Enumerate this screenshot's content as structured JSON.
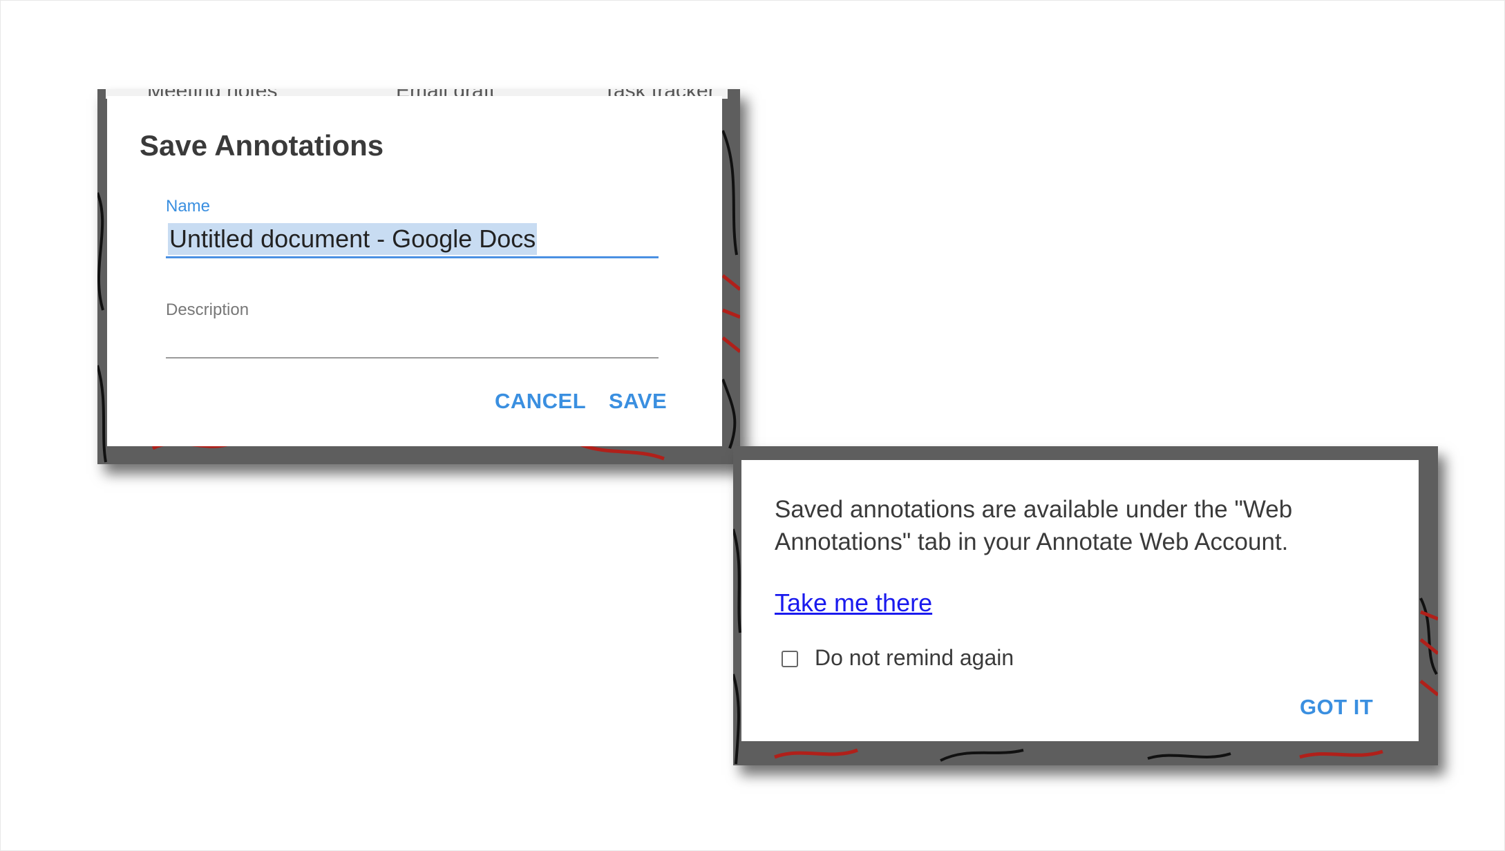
{
  "save_dialog": {
    "background_tabs": [
      "Meeting notes",
      "Email draft",
      "Task tracker"
    ],
    "title": "Save Annotations",
    "name_label": "Name",
    "name_value": "Untitled document - Google Docs",
    "description_label": "Description",
    "description_value": "",
    "cancel_label": "CANCEL",
    "save_label": "SAVE"
  },
  "info_dialog": {
    "message": "Saved annotations are available under the \"Web Annotations\" tab in your Annotate Web Account.",
    "link_label": "Take me there",
    "checkbox_label": "Do not remind again",
    "checkbox_checked": false,
    "got_it_label": "GOT IT"
  },
  "colors": {
    "accent": "#3a8fe0",
    "link": "#1a1aee",
    "text": "#3a3a3a",
    "frame": "#5e5e5e"
  }
}
